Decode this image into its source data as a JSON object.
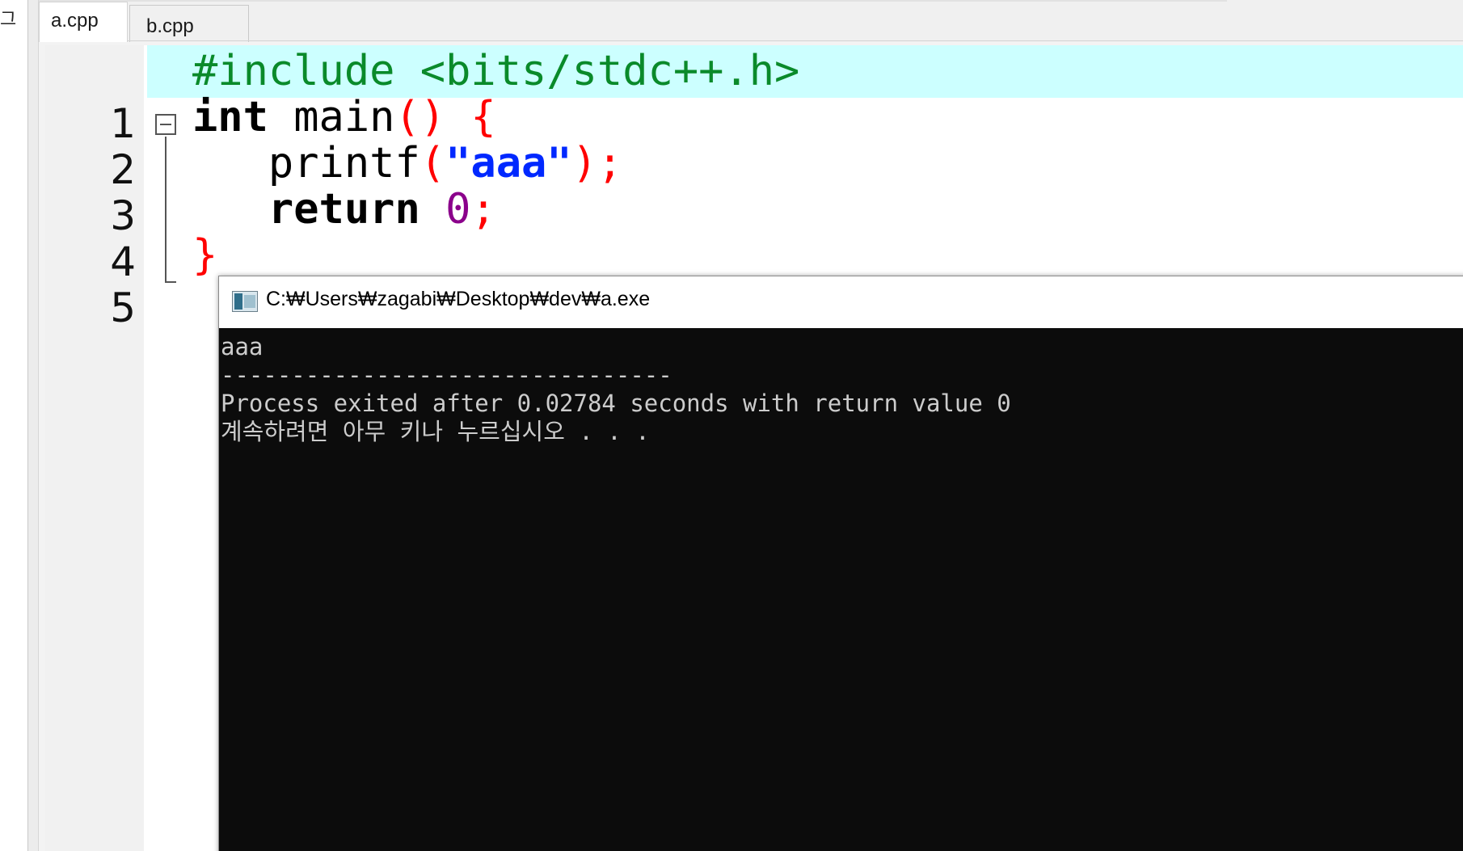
{
  "left_panel": {
    "glyph": "그"
  },
  "tabs": [
    {
      "label": "a.cpp",
      "active": true
    },
    {
      "label": "b.cpp",
      "active": false
    }
  ],
  "editor": {
    "lines": [
      {
        "number": "1",
        "highlighted": true
      },
      {
        "number": "2",
        "highlighted": false
      },
      {
        "number": "3",
        "highlighted": false
      },
      {
        "number": "4",
        "highlighted": false
      },
      {
        "number": "5",
        "highlighted": false
      }
    ],
    "tokens": {
      "include_directive": "#include <bits/stdc++.h>",
      "kw_int": "int",
      "main_name": " main",
      "paren_open_close": "()",
      "brace_open": "{",
      "printf_name": "printf",
      "paren_open": "(",
      "string_literal": "\"aaa\"",
      "paren_close_semi": ");",
      "kw_return": "return",
      "zero": "0",
      "semicolon": ";",
      "brace_close": "}"
    },
    "colors": {
      "preprocessor": "#0a8a2a",
      "bracket": "#ff0000",
      "string": "#0028ff",
      "number": "#8b008b",
      "current_line": "#ccffff"
    }
  },
  "console": {
    "title": "C:₩Users₩zagabi₩Desktop₩dev₩a.exe",
    "output": [
      "aaa",
      "--------------------------------",
      "Process exited after 0.02784 seconds with return value 0",
      "계속하려면 아무 키나 누르십시오 . . ."
    ]
  }
}
